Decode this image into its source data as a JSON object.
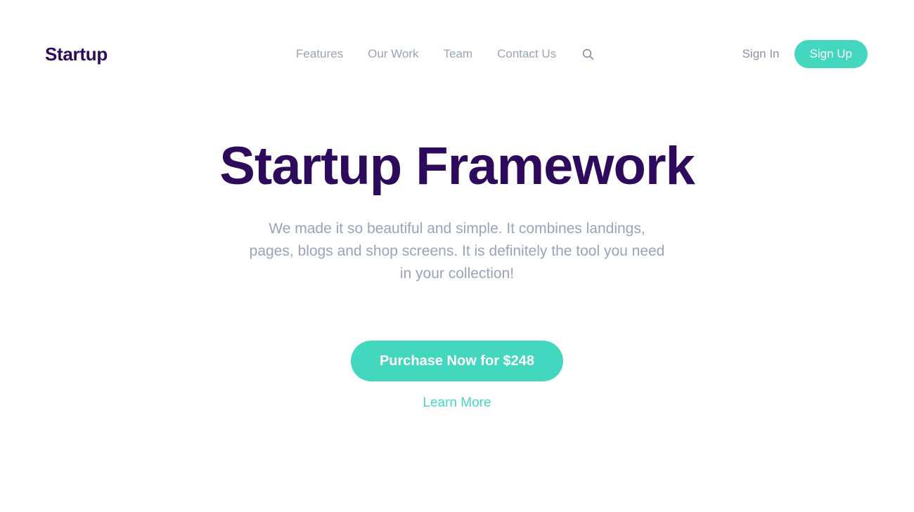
{
  "header": {
    "logo": "Startup",
    "nav": [
      {
        "label": "Features"
      },
      {
        "label": "Our Work"
      },
      {
        "label": "Team"
      },
      {
        "label": "Contact Us"
      }
    ],
    "search_icon": "search-icon",
    "sign_in_label": "Sign In",
    "sign_up_label": "Sign Up"
  },
  "hero": {
    "title": "Startup Framework",
    "subtitle": "We made it so beautiful and simple. It combines landings, pages, blogs and shop screens. It is definitely the tool you need in your collection!",
    "purchase_label": "Purchase Now for $248",
    "learn_more_label": "Learn More"
  },
  "colors": {
    "accent_teal": "#44d7bf",
    "heading_purple": "#2e0a5d",
    "muted_text": "#9aa4b8",
    "background": "#ffffff"
  }
}
